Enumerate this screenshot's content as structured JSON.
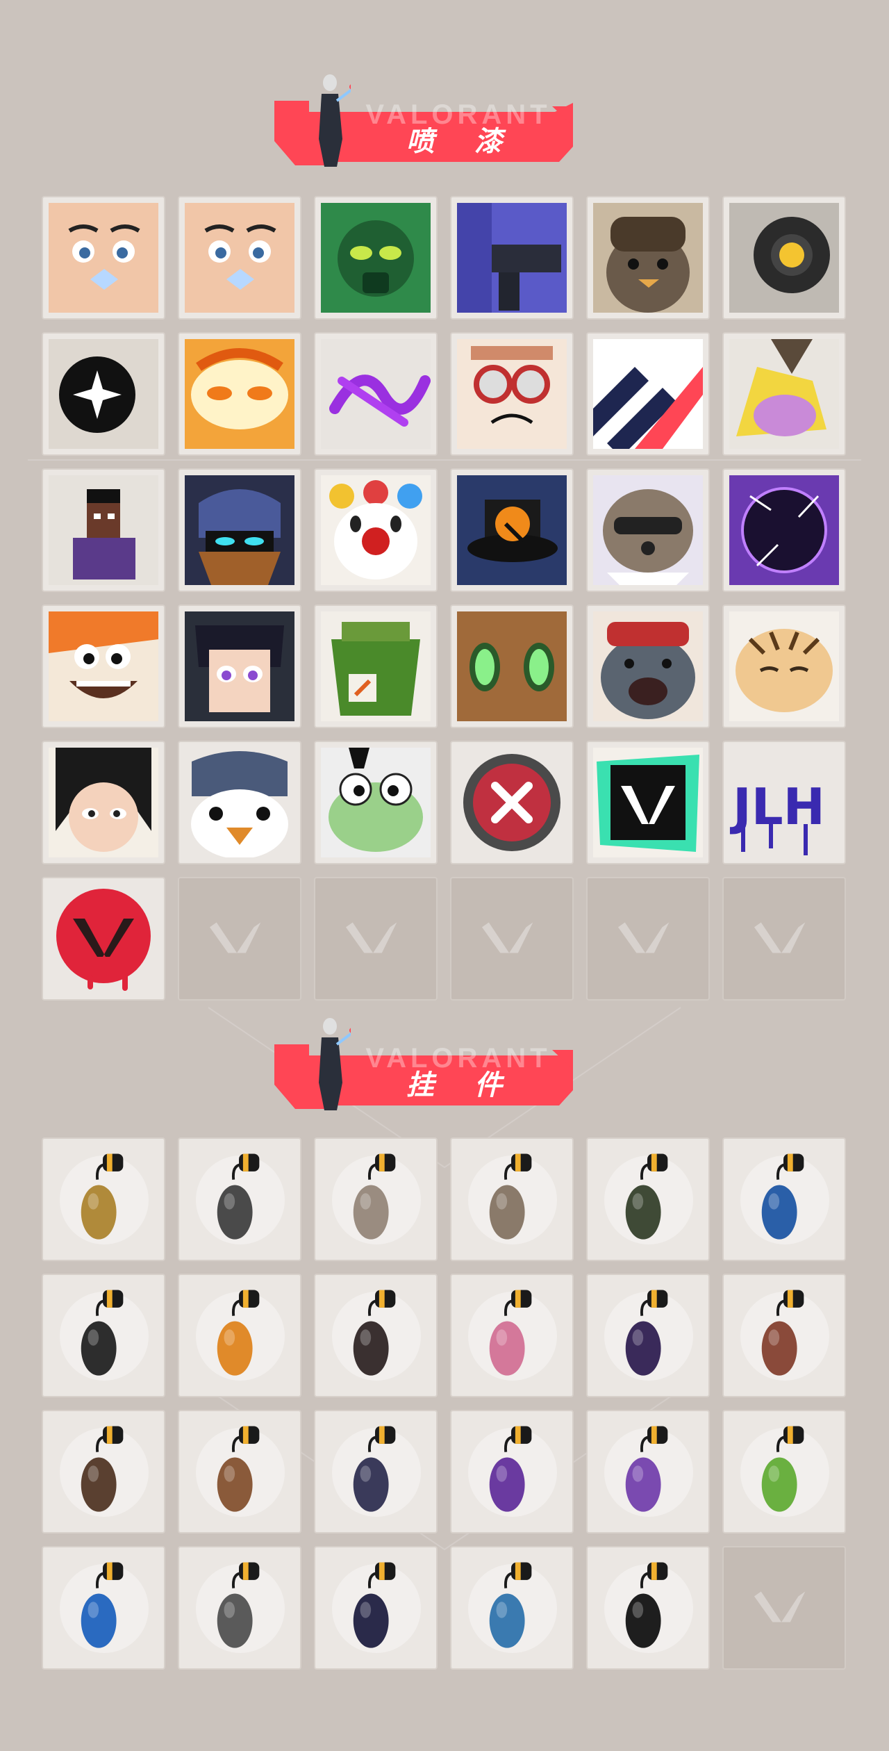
{
  "sections": {
    "sprays": {
      "title": "喷 漆",
      "wordmark": "VALORANT",
      "items": [
        {
          "name": "spray-eyes-butterfly",
          "kind": "face"
        },
        {
          "name": "spray-angry-man",
          "kind": "face"
        },
        {
          "name": "spray-green-mask",
          "kind": "mask"
        },
        {
          "name": "spray-purple-gun",
          "kind": "gun"
        },
        {
          "name": "spray-penguin-beanie",
          "kind": "penguin"
        },
        {
          "name": "spray-camera-bot",
          "kind": "bot"
        },
        {
          "name": "spray-black-star-orb",
          "kind": "orb"
        },
        {
          "name": "spray-fire-cat",
          "kind": "fire"
        },
        {
          "name": "spray-purple-scribble",
          "kind": "scribble"
        },
        {
          "name": "spray-goggles-cat",
          "kind": "goggles"
        },
        {
          "name": "spray-stripes",
          "kind": "stripes"
        },
        {
          "name": "spray-purple-creature",
          "kind": "creature"
        },
        {
          "name": "spray-pixel-agent",
          "kind": "pixel"
        },
        {
          "name": "spray-helmet-agent",
          "kind": "helmet"
        },
        {
          "name": "spray-clown",
          "kind": "clown"
        },
        {
          "name": "spray-top-hat",
          "kind": "hat"
        },
        {
          "name": "spray-raccoon",
          "kind": "raccoon"
        },
        {
          "name": "spray-dark-orb",
          "kind": "darkorb"
        },
        {
          "name": "spray-shouting-agent",
          "kind": "shout"
        },
        {
          "name": "spray-anime-boy",
          "kind": "anime"
        },
        {
          "name": "spray-green-crate",
          "kind": "crate"
        },
        {
          "name": "spray-green-eyes",
          "kind": "greeneyes"
        },
        {
          "name": "spray-crying-seal",
          "kind": "seal"
        },
        {
          "name": "spray-sleepy-tiger",
          "kind": "tiger"
        },
        {
          "name": "spray-determined-girl",
          "kind": "girl"
        },
        {
          "name": "spray-penguin-blue",
          "kind": "penguin2"
        },
        {
          "name": "spray-frog-hat",
          "kind": "frog"
        },
        {
          "name": "spray-x-button",
          "kind": "xbutton"
        },
        {
          "name": "spray-valorant-splat",
          "kind": "vsplat"
        },
        {
          "name": "spray-graffiti-text",
          "kind": "graffiti"
        },
        {
          "name": "spray-red-v-drip",
          "kind": "redv"
        },
        {
          "name": "empty-slot",
          "kind": "empty"
        },
        {
          "name": "empty-slot",
          "kind": "empty"
        },
        {
          "name": "empty-slot",
          "kind": "empty"
        },
        {
          "name": "empty-slot",
          "kind": "empty"
        },
        {
          "name": "empty-slot",
          "kind": "empty"
        }
      ]
    },
    "buddies": {
      "title": "挂 件",
      "wordmark": "VALORANT",
      "items": [
        {
          "name": "buddy-gold-figure",
          "color": "#b08a3a"
        },
        {
          "name": "buddy-robot-drone",
          "color": "#4a4a4a"
        },
        {
          "name": "buddy-cake-box",
          "color": "#9a8c80"
        },
        {
          "name": "buddy-cat-figure",
          "color": "#8a7a6a"
        },
        {
          "name": "buddy-bag",
          "color": "#3f4a36"
        },
        {
          "name": "buddy-bottle",
          "color": "#2a5fa8"
        },
        {
          "name": "buddy-chainsaw",
          "color": "#2d2d2d"
        },
        {
          "name": "buddy-pepper",
          "color": "#e08a2a"
        },
        {
          "name": "buddy-rope",
          "color": "#3a3030"
        },
        {
          "name": "buddy-cupcake",
          "color": "#d4789a"
        },
        {
          "name": "buddy-ep9-badge",
          "color": "#3a2a5a"
        },
        {
          "name": "buddy-bear-bell",
          "color": "#8a4a3a"
        },
        {
          "name": "buddy-weapon-box",
          "color": "#5a4030"
        },
        {
          "name": "buddy-crate",
          "color": "#8a5a3a"
        },
        {
          "name": "buddy-gramophone",
          "color": "#3a3a5a"
        },
        {
          "name": "buddy-purple-crystal",
          "color": "#6a3aa0"
        },
        {
          "name": "buddy-lava-lamp",
          "color": "#7a4ab0"
        },
        {
          "name": "buddy-green-device",
          "color": "#6ab040"
        },
        {
          "name": "buddy-astronaut",
          "color": "#2a6ac0"
        },
        {
          "name": "buddy-radio",
          "color": "#5a5a5a"
        },
        {
          "name": "buddy-ep9-coin",
          "color": "#2a2a4a"
        },
        {
          "name": "buddy-ufo",
          "color": "#3a7ab0"
        },
        {
          "name": "buddy-v-medallion",
          "color": "#1e1e1e"
        },
        {
          "name": "empty-slot",
          "color": ""
        }
      ]
    }
  }
}
